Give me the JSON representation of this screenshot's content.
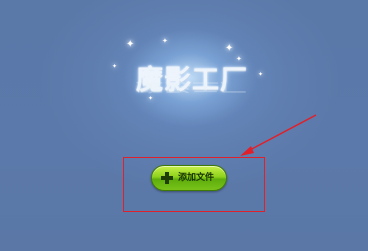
{
  "app": {
    "logo_text": "魔影工厂"
  },
  "main": {
    "add_file_label": "添加文件"
  },
  "icons": {
    "add": "plus-icon",
    "annotation": "red-arrow-icon"
  },
  "colors": {
    "background": "#5a77a7",
    "button_green": "#8fd21c",
    "annotation_red": "#e0202a"
  }
}
